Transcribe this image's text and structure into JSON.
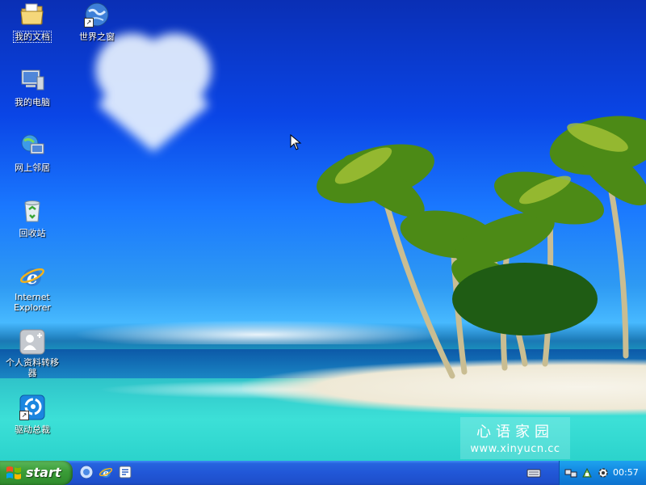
{
  "desktop": {
    "icons": [
      {
        "label": "我的文档",
        "icon": "my-documents-folder-icon",
        "selected": true
      },
      {
        "label": "世界之窗",
        "icon": "world-window-browser-icon"
      },
      {
        "label": "我的电脑",
        "icon": "my-computer-icon"
      },
      {
        "label": "网上邻居",
        "icon": "network-places-icon"
      },
      {
        "label": "回收站",
        "icon": "recycle-bin-icon"
      },
      {
        "label_line1": "Internet",
        "label_line2": "Explorer",
        "icon": "internet-explorer-icon"
      },
      {
        "label_line1": "个人资料转移",
        "label_line2": "器",
        "icon": "profile-transfer-icon"
      },
      {
        "label": "驱动总裁",
        "icon": "driver-manager-icon"
      }
    ]
  },
  "watermark": {
    "line1": "心语家园",
    "line2": "www.xinyucn.cc"
  },
  "taskbar": {
    "start_label": "start",
    "quick_launch": [
      "desktop-icon",
      "internet-explorer-icon",
      "notes-icon"
    ],
    "tray_icons": [
      "network-icon",
      "safely-remove-icon",
      "gear-icon"
    ],
    "clock": "00:57"
  },
  "colors": {
    "taskbar_blue": "#2157d7",
    "start_green": "#3a9c37",
    "tray_blue": "#1286e0",
    "sky_deep": "#0a2fb5",
    "sea_cyan": "#33d8d3"
  }
}
